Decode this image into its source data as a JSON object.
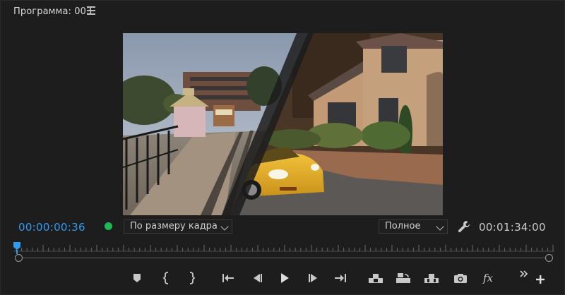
{
  "panel": {
    "title": "Программа: 003",
    "menu_icon": "hamburger-menu-icon"
  },
  "timecode": {
    "current": "00:00:00:36",
    "current_color": "#2f9bf0",
    "duration": "00:01:34:00"
  },
  "status": {
    "indicator_color": "#1db954"
  },
  "fit_dropdown": {
    "selected": "По размеру кадра"
  },
  "quality_dropdown": {
    "selected": "Полное"
  },
  "transport_controls": [
    {
      "name": "add-marker-icon"
    },
    {
      "name": "mark-in-icon"
    },
    {
      "name": "mark-out-icon"
    },
    {
      "name": "go-to-in-icon"
    },
    {
      "name": "step-back-icon"
    },
    {
      "name": "play-icon"
    },
    {
      "name": "step-forward-icon"
    },
    {
      "name": "go-to-out-icon"
    },
    {
      "name": "lift-icon"
    },
    {
      "name": "extract-icon"
    },
    {
      "name": "export-frame-multicam-icon"
    },
    {
      "name": "camera-icon"
    },
    {
      "name": "fx-icon",
      "label": "fx"
    },
    {
      "name": "more-controls-icon"
    },
    {
      "name": "add-button-icon"
    }
  ]
}
